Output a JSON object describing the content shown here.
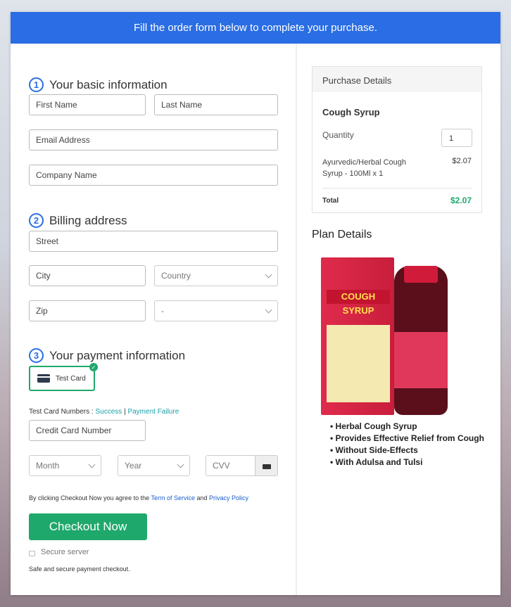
{
  "banner": "Fill the order form below to complete your purchase.",
  "sections": [
    {
      "num": "1",
      "title": "Your basic information"
    },
    {
      "num": "2",
      "title": "Billing address"
    },
    {
      "num": "3",
      "title": "Your payment information"
    }
  ],
  "fields": {
    "first_name": "First Name",
    "last_name": "Last Name",
    "email": "Email Address",
    "company": "Company Name",
    "street": "Street",
    "city": "City",
    "country": "Country",
    "zip": "Zip",
    "state": "-",
    "card_number": "Credit Card Number",
    "month": "Month",
    "year": "Year",
    "cvv": "CVV"
  },
  "payment": {
    "method": "Test Card",
    "test_numbers_label": "Test Card Numbers : ",
    "success": "Success",
    "separator": "|",
    "failure": "Payment Failure"
  },
  "terms": {
    "prefix": "By clicking Checkout Now you agree to the ",
    "tos": "Term of Service",
    "and": " and ",
    "privacy": "Privacy Policy"
  },
  "checkout_label": "Checkout Now",
  "secure_server": "Secure server",
  "safe_text": "Safe and secure payment checkout.",
  "purchase": {
    "header": "Purchase Details",
    "product": "Cough Syrup",
    "quantity_label": "Quantity",
    "quantity": "1",
    "item_line1": "Ayurvedic/Herbal Cough",
    "item_line2": "Syrup - 100Ml x 1",
    "item_price": "$2.07",
    "total_label": "Total",
    "total": "$2.07"
  },
  "plan": {
    "title": "Plan Details",
    "product_image_text": "COUGH SYRUP",
    "bullets": [
      "Herbal Cough Syrup",
      "Provides Effective Relief from Cough",
      "Without Side-Effects",
      "With Adulsa and Tulsi"
    ]
  },
  "colors": {
    "accent": "#2a6de4",
    "checkout": "#1fa86b",
    "total": "#1fa86b"
  }
}
